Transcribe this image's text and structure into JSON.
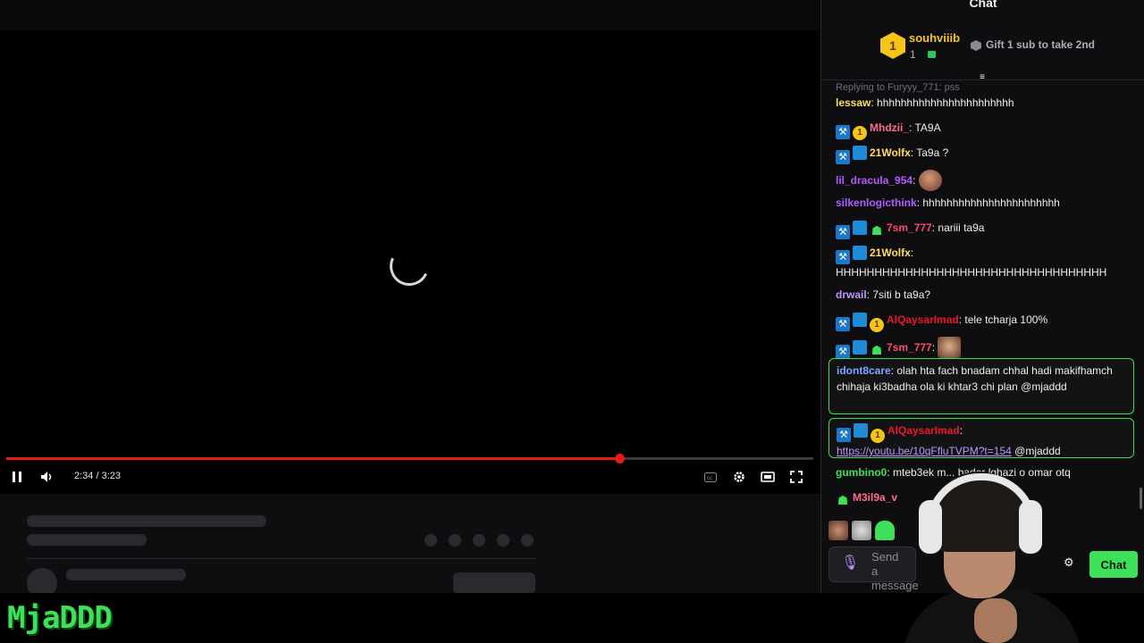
{
  "player": {
    "current_time": "2:34",
    "duration": "3:23",
    "progress": 0.76
  },
  "chat": {
    "title": "Chat",
    "leaderboard": {
      "rank": "1",
      "name": "souhviiib",
      "count": "1",
      "gift_text": "Gift 1 sub to take 2nd"
    },
    "reply_context": "Replying to Furyyy_771: pss",
    "messages": [
      {
        "user": "lessaw",
        "color": "#ffde59",
        "badges": [],
        "text": "hhhhhhhhhhhhhhhhhhhhhhh"
      },
      {
        "user": "Mhdzii_",
        "color": "#ff6b8a",
        "badges": [
          "hammer",
          "gold"
        ],
        "text": "TA9A"
      },
      {
        "user": "21Wolfx",
        "color": "#ffde59",
        "badges": [
          "hammer",
          "gift"
        ],
        "text": "Ta9a ?"
      },
      {
        "user": "lil_dracula_954",
        "color": "#b05cff",
        "badges": [],
        "text": ""
      },
      {
        "user": "silkenlogicthink",
        "color": "#b05cff",
        "badges": [],
        "text": "hhhhhhhhhhhhhhhhhhhhhhh"
      },
      {
        "user": "7sm_777",
        "color": "#ff4a6b",
        "badges": [
          "hammer",
          "gift",
          "ghost"
        ],
        "text": "nariii ta9a"
      },
      {
        "user": "21Wolfx",
        "color": "#ffde59",
        "badges": [
          "hammer",
          "gift"
        ],
        "text": "HHHHHHHHHHHHHHHHHHHHHHHHHHHHHHHHHHH"
      },
      {
        "user": "drwail",
        "color": "#bf94ff",
        "badges": [],
        "text": "7siti b ta9a?"
      },
      {
        "user": "AlQaysarImad",
        "color": "#e8192c",
        "badges": [
          "hammer",
          "gift",
          "gold"
        ],
        "text": "tele tcharja 100%"
      },
      {
        "user": "7sm_777",
        "color": "#ff4a6b",
        "badges": [
          "hammer",
          "gift",
          "ghost"
        ],
        "text": ""
      },
      {
        "user": "idont8care",
        "color": "#7aa7ff",
        "badges": [],
        "text": "olah hta fach bnadam chhal hadi makifhamch chihaja ki3badha ola ki khtar3 chi plan @mjaddd"
      },
      {
        "user": "AlQaysarImad",
        "color": "#e8192c",
        "badges": [
          "hammer",
          "gift",
          "gold"
        ],
        "link": "https://youtu.be/10qFfluTVPM?t=154",
        "text": "@mjaddd"
      },
      {
        "user": "gumbino0",
        "color": "#3ee05a",
        "badges": [],
        "text": "mteb3ek m... bader lghazi o omar otq"
      },
      {
        "user": "M3il9a_v",
        "color": "#ff6b8a",
        "badges": [
          "ghost"
        ],
        "text": ""
      }
    ],
    "input_placeholder": "Send a message",
    "send_label": "Chat",
    "accent": "#3ee05a"
  },
  "watermark": "MjaDDD"
}
